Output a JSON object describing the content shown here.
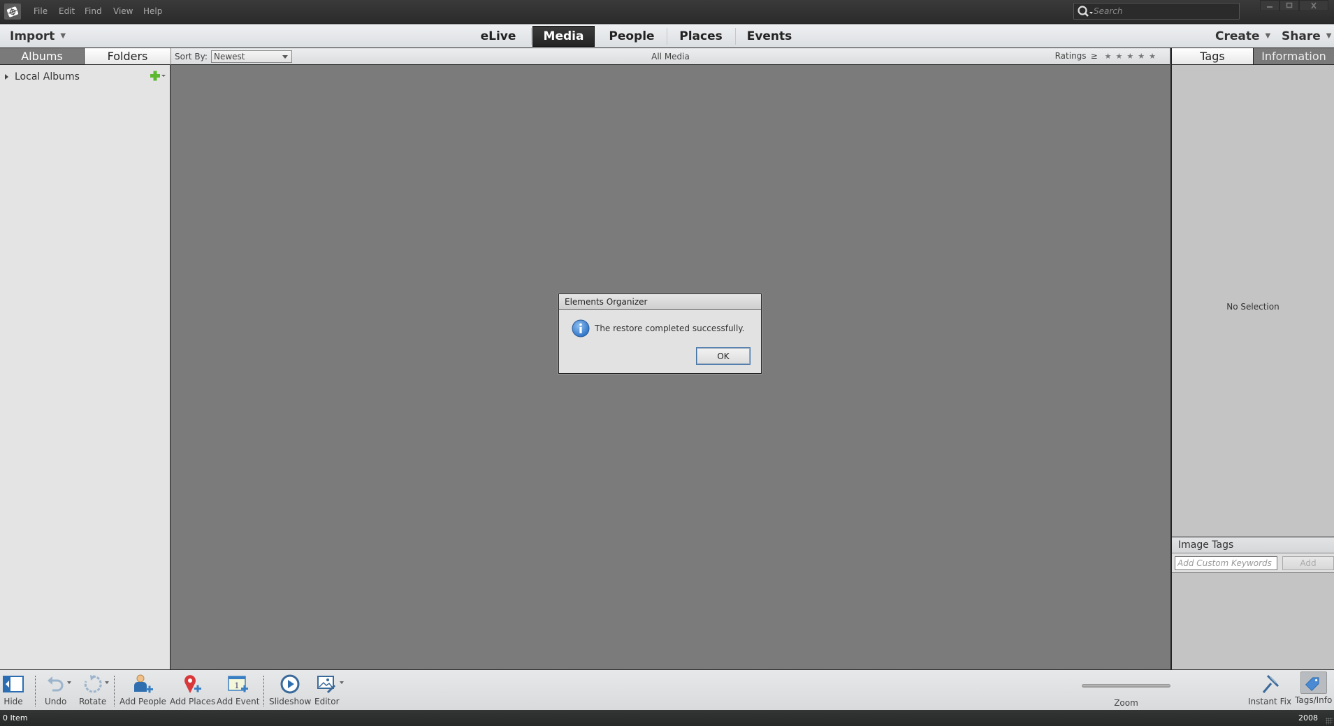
{
  "titlebar": {
    "menus": [
      "File",
      "Edit",
      "Find",
      "View",
      "Help"
    ],
    "search_placeholder": "Search",
    "window_controls": [
      "minimize-icon",
      "maximize-icon",
      "close-icon"
    ]
  },
  "navbar": {
    "import_label": "Import",
    "tabs": [
      {
        "label": "eLive",
        "active": false
      },
      {
        "label": "Media",
        "active": true
      },
      {
        "label": "People",
        "active": false
      },
      {
        "label": "Places",
        "active": false
      },
      {
        "label": "Events",
        "active": false
      }
    ],
    "create_label": "Create",
    "share_label": "Share"
  },
  "left_panel": {
    "tabs": [
      {
        "label": "Albums",
        "active": true
      },
      {
        "label": "Folders",
        "active": false
      }
    ],
    "tree": [
      {
        "label": "Local Albums",
        "expanded": false
      }
    ],
    "add_icon": "plus-icon"
  },
  "subbar": {
    "sort_by_label": "Sort By:",
    "sort_by_value": "Newest",
    "view_title": "All Media",
    "ratings_label": "Ratings",
    "ratings_operator": "≥",
    "ratings_filter_stars": 0,
    "ratings_max_stars": 5
  },
  "right_panel": {
    "tabs": [
      {
        "label": "Tags",
        "active": false
      },
      {
        "label": "Information",
        "active": true
      }
    ],
    "empty_message": "No Selection",
    "image_tags": {
      "header": "Image Tags",
      "keyword_placeholder": "Add Custom Keywords",
      "add_label": "Add"
    }
  },
  "toolbar": {
    "tools": [
      {
        "label": "Hide",
        "icon": "hide-panel-icon"
      },
      {
        "label": "Undo",
        "icon": "undo-icon"
      },
      {
        "label": "Rotate",
        "icon": "rotate-icon"
      },
      {
        "label": "Add People",
        "icon": "add-people-icon"
      },
      {
        "label": "Add Places",
        "icon": "add-places-icon"
      },
      {
        "label": "Add Event",
        "icon": "add-event-icon"
      },
      {
        "label": "Slideshow",
        "icon": "slideshow-icon"
      },
      {
        "label": "Editor",
        "icon": "editor-icon"
      }
    ],
    "zoom_label": "Zoom",
    "instant_fix_label": "Instant Fix",
    "tags_info_label": "Tags/Info",
    "event_icon_number": "1"
  },
  "statusbar": {
    "item_count": "0 Item",
    "year": "2008"
  },
  "dialog": {
    "title": "Elements Organizer",
    "message": "The restore completed successfully.",
    "ok_label": "OK",
    "icon": "info-icon"
  },
  "colors": {
    "titlebar_bg": "#2f2f2f",
    "content_bg": "#7b7b7b",
    "active_tab_bg": "#2a2a2a",
    "right_panel_bg": "#c4c4c4",
    "accent_blue": "#3a7fc4",
    "places_red": "#d9383a",
    "add_green": "#5cb82e"
  }
}
